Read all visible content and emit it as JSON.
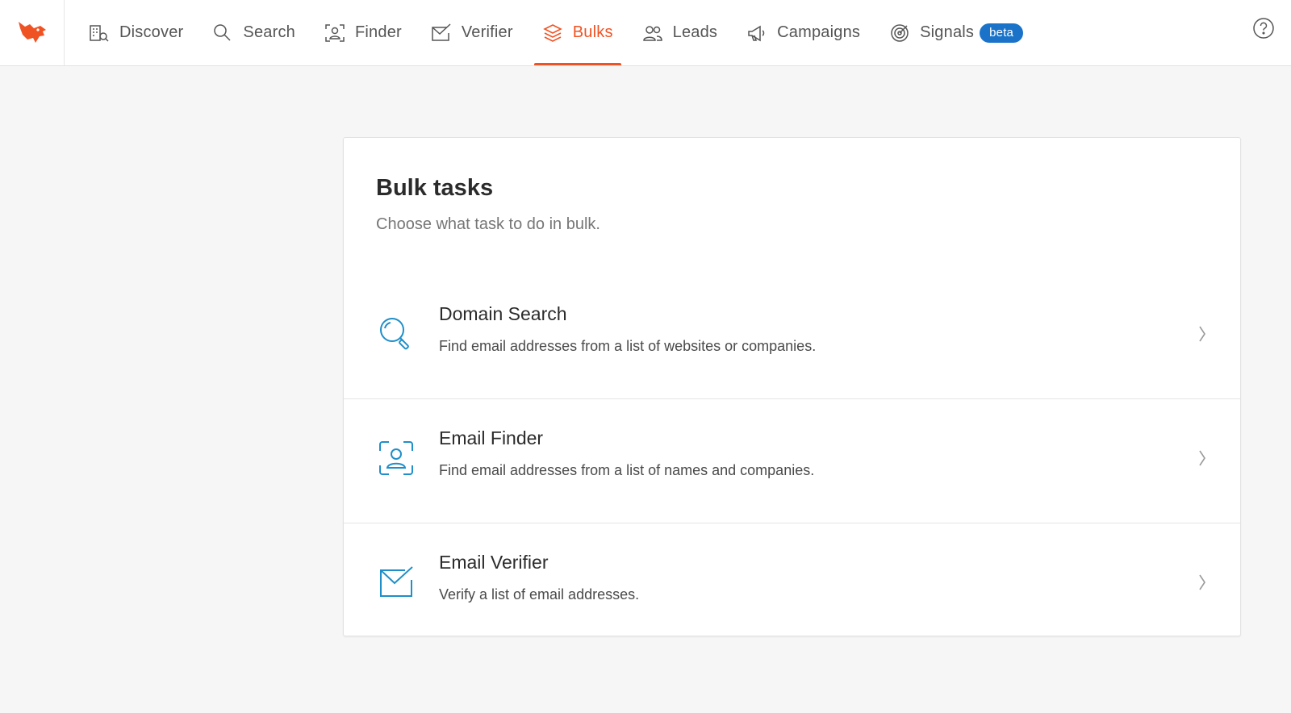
{
  "nav": {
    "items": [
      {
        "label": "Discover",
        "icon": "building-search-icon"
      },
      {
        "label": "Search",
        "icon": "search-icon"
      },
      {
        "label": "Finder",
        "icon": "user-scan-icon"
      },
      {
        "label": "Verifier",
        "icon": "mail-check-icon"
      },
      {
        "label": "Bulks",
        "icon": "layers-icon",
        "active": true
      },
      {
        "label": "Leads",
        "icon": "users-icon"
      },
      {
        "label": "Campaigns",
        "icon": "megaphone-icon"
      },
      {
        "label": "Signals",
        "icon": "target-icon",
        "badge": "beta"
      }
    ]
  },
  "header": {
    "logo": "fox-logo-icon",
    "help_icon": "help-circle-icon"
  },
  "card": {
    "title": "Bulk tasks",
    "subtitle": "Choose what task to do in bulk.",
    "tasks": [
      {
        "title": "Domain Search",
        "description": "Find email addresses from a list of websites or companies.",
        "icon": "search-icon"
      },
      {
        "title": "Email Finder",
        "description": "Find email addresses from a list of names and companies.",
        "icon": "user-scan-icon"
      },
      {
        "title": "Email Verifier",
        "description": "Verify a list of email addresses.",
        "icon": "mail-check-icon"
      }
    ]
  },
  "colors": {
    "accent": "#f05323",
    "badge": "#1a73c9",
    "task_icon": "#1f8fc9",
    "background": "#f6f6f6"
  }
}
